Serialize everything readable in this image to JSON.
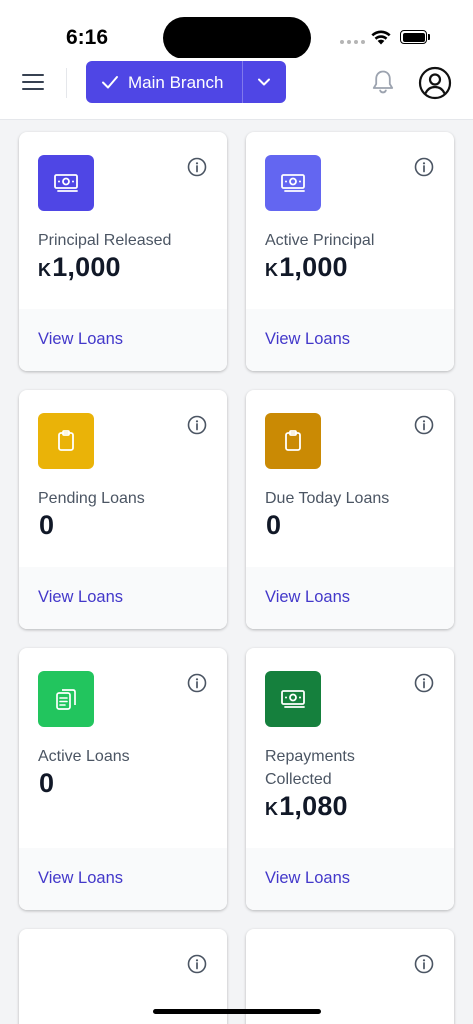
{
  "status": {
    "time": "6:16"
  },
  "header": {
    "branch_label": "Main Branch"
  },
  "colors": {
    "accent": "#4f46e5",
    "icon_purple_dark": "#4f46e5",
    "icon_purple_light": "#6366f1",
    "icon_yellow": "#eab308",
    "icon_amber": "#ca8a04",
    "icon_green": "#22c55e",
    "icon_green_dark": "#15803d"
  },
  "cards": [
    {
      "label": "Principal Released",
      "currency": "K",
      "value": "1,000",
      "link": "View Loans",
      "icon": "money-icon"
    },
    {
      "label": "Active Principal",
      "currency": "K",
      "value": "1,000",
      "link": "View Loans",
      "icon": "money-icon"
    },
    {
      "label": "Pending Loans",
      "currency": "",
      "value": "0",
      "link": "View Loans",
      "icon": "clipboard-icon"
    },
    {
      "label": "Due Today Loans",
      "currency": "",
      "value": "0",
      "link": "View Loans",
      "icon": "clipboard-icon"
    },
    {
      "label": "Active Loans",
      "currency": "",
      "value": "0",
      "link": "View Loans",
      "icon": "clipboard-list-icon"
    },
    {
      "label": "Repayments Collected",
      "currency": "K",
      "value": "1,080",
      "link": "View Loans",
      "icon": "money-icon"
    }
  ]
}
